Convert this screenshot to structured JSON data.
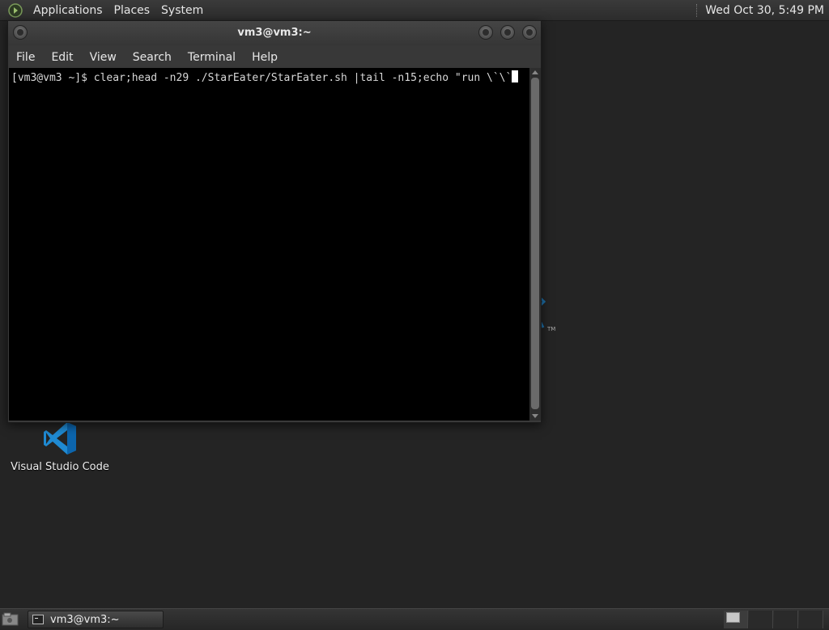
{
  "top_panel": {
    "menus": [
      "Applications",
      "Places",
      "System"
    ],
    "clock": "Wed Oct 30,  5:49 PM"
  },
  "desktop": {
    "launcher_label": "Visual Studio Code",
    "accent_color": "#0078d4"
  },
  "terminal": {
    "title": "vm3@vm3:~",
    "menu": [
      "File",
      "Edit",
      "View",
      "Search",
      "Terminal",
      "Help"
    ],
    "prompt": "[vm3@vm3 ~]$ ",
    "command": "clear;head -n29 ./StarEater/StarEater.sh |tail -n15;echo \"run \\`\\`"
  },
  "bottom_panel": {
    "task_label": "vm3@vm3:~"
  }
}
